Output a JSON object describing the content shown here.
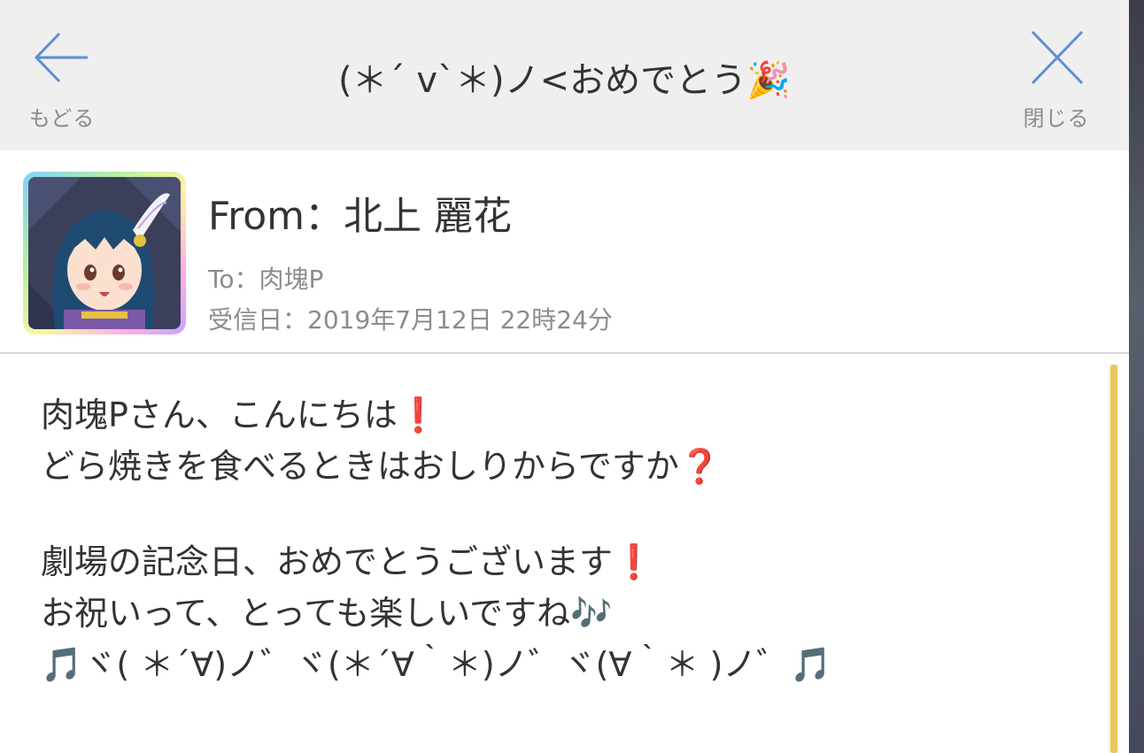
{
  "header": {
    "title": "(＊´ v`＊)ノ<おめでとう🎉",
    "back_label": "もどる",
    "close_label": "閉じる"
  },
  "message": {
    "from": "From：北上 麗花",
    "to": "To：肉塊P",
    "received": "受信日：2019年7月12日 22時24分",
    "lines": [
      "肉塊Pさん、こんにちは❗",
      "どら焼きを食べるときはおしりからですか❓",
      "",
      "劇場の記念日、おめでとうございます❗",
      "お祝いって、とっても楽しいですね🎶",
      "🎵ヾ( ＊´∀)ノ゛ヾ(＊´∀｀＊)ノ゛ヾ(∀｀＊ )ノ゛🎵"
    ]
  },
  "colors": {
    "header_bg": "#efefef",
    "accent_blue": "#5a8fd6",
    "scroll_thumb": "#e8c85a"
  }
}
